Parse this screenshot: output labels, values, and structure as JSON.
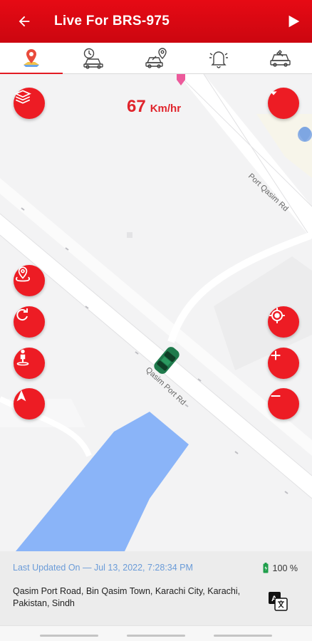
{
  "appbar": {
    "title": "Live For BRS-975"
  },
  "tabs": [
    {
      "icon": "map-pin-icon",
      "active": true
    },
    {
      "icon": "history-car-icon",
      "active": false
    },
    {
      "icon": "car-location-icon",
      "active": false
    },
    {
      "icon": "bell-icon",
      "active": false
    },
    {
      "icon": "car-service-icon",
      "active": false
    }
  ],
  "map": {
    "speed_value": "67",
    "speed_unit": "Km/hr",
    "road_labels": {
      "port_qasim": "Port Qasim Rd",
      "qasim_port": "Qasim Port Rd"
    }
  },
  "info": {
    "last_updated": "Last Updated On — Jul 13, 2022, 7:28:34 PM",
    "battery": "100 %",
    "address": "Qasim Port Road, Bin Qasim Town, Karachi City, Karachi, Pakistan, Sindh"
  },
  "colors": {
    "primary": "#e60a14",
    "link": "#6a9bd8",
    "water": "#8ab4f8",
    "car": "#1f7a4c"
  }
}
